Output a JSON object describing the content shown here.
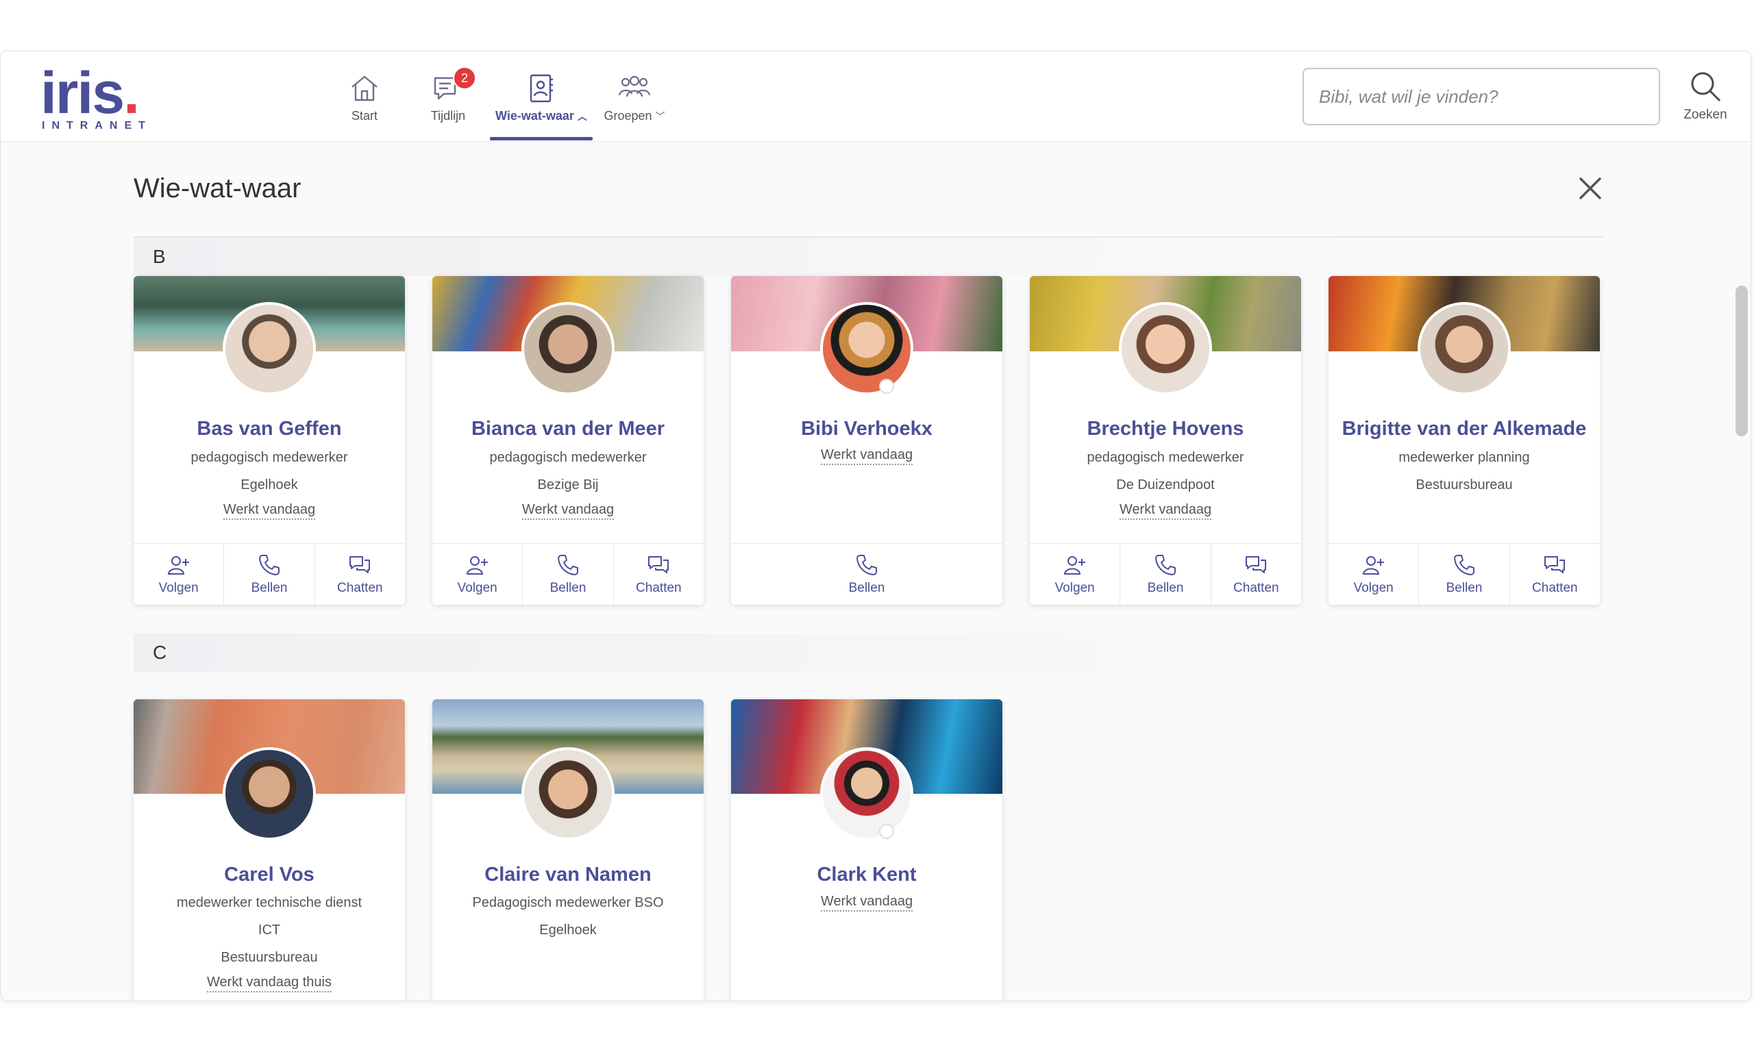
{
  "app": {
    "logo_text": "iris",
    "logo_dot": ".",
    "logo_sub": "INTRANET"
  },
  "nav": {
    "items": [
      {
        "label": "Start",
        "icon": "home-icon"
      },
      {
        "label": "Tijdlijn",
        "icon": "chat-icon",
        "badge": "2"
      },
      {
        "label": "Wie-wat-waar",
        "icon": "contacts-icon",
        "active": true
      },
      {
        "label": "Groepen",
        "icon": "groups-icon"
      }
    ]
  },
  "search": {
    "placeholder": "Bibi, wat wil je vinden?",
    "button_label": "Zoeken"
  },
  "panel": {
    "title": "Wie-wat-waar"
  },
  "sections": [
    {
      "letter": "B",
      "people": [
        {
          "name": "Bas van Geffen",
          "role": "pedagogisch medewerker",
          "location": "Egelhoek",
          "status": "Werkt vandaag",
          "actions": [
            "Volgen",
            "Bellen",
            "Chatten"
          ]
        },
        {
          "name": "Bianca van der Meer",
          "role": "pedagogisch medewerker",
          "location": "Bezige Bij",
          "status": "Werkt vandaag",
          "actions": [
            "Volgen",
            "Bellen",
            "Chatten"
          ]
        },
        {
          "name": "Bibi Verhoekx",
          "status": "Werkt vandaag",
          "actions": [
            "Bellen"
          ]
        },
        {
          "name": "Brechtje Hovens",
          "role": "pedagogisch medewerker",
          "location": "De Duizendpoot",
          "status": "Werkt vandaag",
          "actions": [
            "Volgen",
            "Bellen",
            "Chatten"
          ]
        },
        {
          "name": "Brigitte van der Alkemade",
          "role": "medewerker planning",
          "location": "Bestuursbureau",
          "actions": [
            "Volgen",
            "Bellen",
            "Chatten"
          ]
        }
      ]
    },
    {
      "letter": "C",
      "people": [
        {
          "name": "Carel Vos",
          "role": "medewerker technische dienst",
          "department": "ICT",
          "location": "Bestuursbureau",
          "status": "Werkt vandaag thuis"
        },
        {
          "name": "Claire van Namen",
          "role": "Pedagogisch medewerker BSO",
          "location": "Egelhoek"
        },
        {
          "name": "Clark Kent",
          "status": "Werkt vandaag"
        }
      ]
    }
  ],
  "colors": {
    "brand": "#4b4f98",
    "accent_red": "#e0414c",
    "badge": "#e03a3a"
  }
}
